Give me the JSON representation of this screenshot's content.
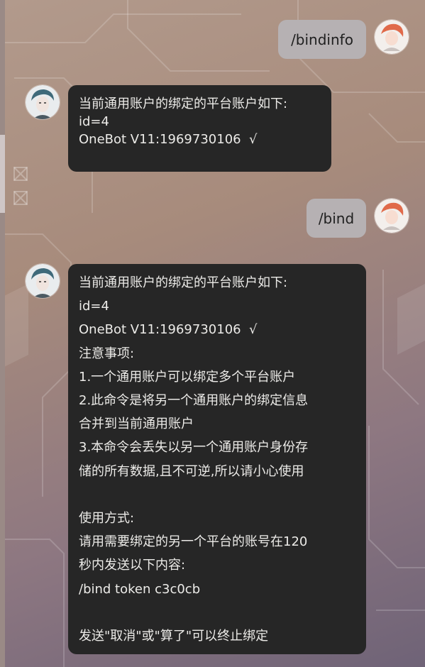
{
  "messages": [
    {
      "sender": "user",
      "text": "/bindinfo"
    },
    {
      "sender": "bot",
      "lines": [
        "当前通用账户的绑定的平台账户如下:",
        "id=4",
        "OneBot V11:1969730106  √"
      ]
    },
    {
      "sender": "user",
      "text": "/bind"
    },
    {
      "sender": "bot",
      "lines": [
        "当前通用账户的绑定的平台账户如下:",
        "id=4",
        "OneBot V11:1969730106  √",
        "注意事项:",
        "1.一个通用账户可以绑定多个平台账户",
        "2.此命令是将另一个通用账户的绑定信息",
        "合并到当前通用账户",
        "3.本命令会丢失以另一个通用账户身份存",
        "储的所有数据,且不可逆,所以请小心使用",
        "",
        "使用方式:",
        "请用需要绑定的另一个平台的账号在120",
        "秒内发送以下内容:",
        "/bind token c3c0cb",
        "",
        "发送\"取消\"或\"算了\"可以终止绑定"
      ]
    }
  ],
  "colors": {
    "user_bubble": "#b6b1b3",
    "bot_bubble": "#262626",
    "bot_text": "#ecebe8"
  },
  "icons": {
    "user_avatar": "user-avatar-icon",
    "bot_avatar": "bot-avatar-icon"
  }
}
